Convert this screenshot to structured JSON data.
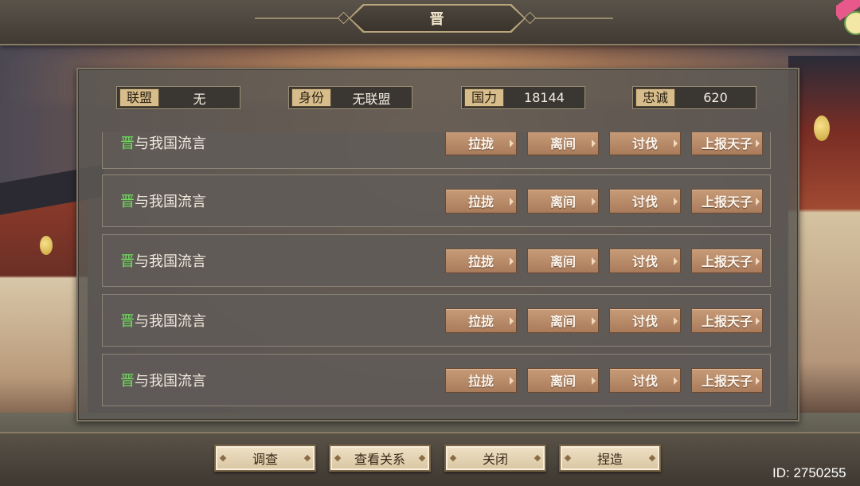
{
  "header": {
    "title": "晋"
  },
  "info": [
    {
      "label": "联盟",
      "value": "无"
    },
    {
      "label": "身份",
      "value": "无联盟"
    },
    {
      "label": "国力",
      "value": "18144"
    },
    {
      "label": "忠诚",
      "value": "620"
    }
  ],
  "rows": [
    {
      "state": "晋",
      "text": "与我国流言",
      "actions": [
        "拉拢",
        "离间",
        "讨伐",
        "上报天子"
      ]
    },
    {
      "state": "晋",
      "text": "与我国流言",
      "actions": [
        "拉拢",
        "离间",
        "讨伐",
        "上报天子"
      ]
    },
    {
      "state": "晋",
      "text": "与我国流言",
      "actions": [
        "拉拢",
        "离间",
        "讨伐",
        "上报天子"
      ]
    },
    {
      "state": "晋",
      "text": "与我国流言",
      "actions": [
        "拉拢",
        "离间",
        "讨伐",
        "上报天子"
      ]
    },
    {
      "state": "晋",
      "text": "与我国流言",
      "actions": [
        "拉拢",
        "离间",
        "讨伐",
        "上报天子"
      ]
    }
  ],
  "footer": {
    "buttons": [
      "调查",
      "查看关系",
      "关闭",
      "捏造"
    ],
    "id_label": "ID: 2750255"
  },
  "colors": {
    "state_green": "#6ee05a",
    "button_brown": "#b88a68",
    "panel": "#5c5854"
  }
}
